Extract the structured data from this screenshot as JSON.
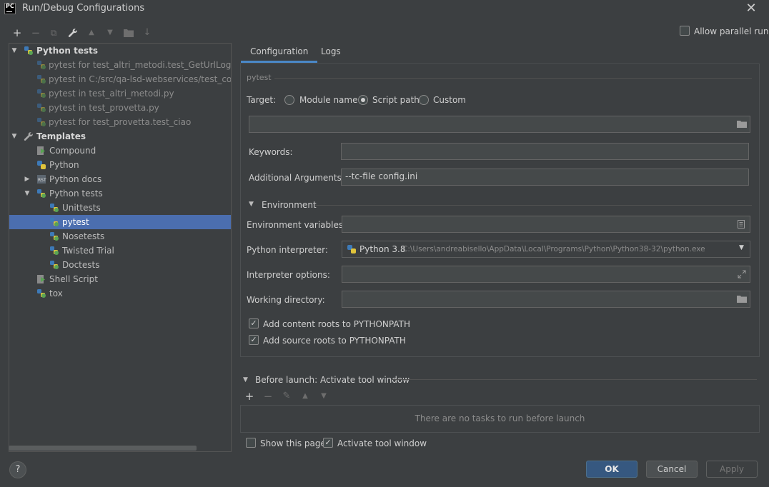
{
  "window": {
    "title": "Run/Debug Configurations",
    "icon_text": "PC",
    "close": "✕"
  },
  "toolbar": {
    "add": "+",
    "remove": "−",
    "copy": "⧉",
    "edit_templates": "🔧",
    "move_up": "▲",
    "move_down": "▼",
    "folder": "📁",
    "sort": "↓"
  },
  "parallel": {
    "label": "Allow parallel run",
    "checked": false
  },
  "tree": {
    "python_tests": "Python tests",
    "items": [
      "pytest for test_altri_metodi.test_GetUrlLoginUser",
      "pytest in C:/src/qa-lsd-webservices/test_configu",
      "pytest in test_altri_metodi.py",
      "pytest in test_provetta.py",
      "pytest for test_provetta.test_ciao"
    ],
    "templates": "Templates",
    "template_items": {
      "compound": "Compound",
      "python": "Python",
      "python_docs": "Python docs",
      "python_tests": "Python tests",
      "unittests": "Unittests",
      "pytest": "pytest",
      "nosetests": "Nosetests",
      "twisted_trial": "Twisted Trial",
      "doctests": "Doctests",
      "shell_script": "Shell Script",
      "tox": "tox"
    }
  },
  "tabs": {
    "configuration": "Configuration",
    "logs": "Logs"
  },
  "form": {
    "section": "pytest",
    "target_label": "Target:",
    "target_options": {
      "module": "Module name",
      "script": "Script path",
      "custom": "Custom"
    },
    "target_selected": "Script path",
    "script_path": "",
    "keywords_label": "Keywords:",
    "keywords_value": "",
    "additional_args_label": "Additional Arguments:",
    "additional_args_value": "--tc-file config.ini",
    "environment_section": "Environment",
    "env_vars_label": "Environment variables:",
    "env_vars_value": "",
    "interpreter_label": "Python interpreter:",
    "interpreter_name": "Python 3.8",
    "interpreter_path": "C:\\Users\\andreabisello\\AppData\\Local\\Programs\\Python\\Python38-32\\python.exe",
    "interpreter_options_label": "Interpreter options:",
    "interpreter_options_value": "",
    "working_dir_label": "Working directory:",
    "working_dir_value": "",
    "content_roots": {
      "label": "Add content roots to PYTHONPATH",
      "checked": true
    },
    "source_roots": {
      "label": "Add source roots to PYTHONPATH",
      "checked": true
    }
  },
  "before_launch": {
    "title": "Before launch: Activate tool window",
    "empty_text": "There are no tasks to run before launch",
    "add": "+",
    "remove": "−",
    "edit": "✎",
    "up": "▲",
    "down": "▼"
  },
  "bottom_options": {
    "show_page": {
      "label": "Show this page",
      "checked": false
    },
    "activate_tool_window": {
      "label": "Activate tool window",
      "checked": true
    }
  },
  "buttons": {
    "help": "?",
    "ok": "OK",
    "cancel": "Cancel",
    "apply": "Apply"
  },
  "colors": {
    "background": "#3c3f41",
    "selection": "#4b6eaf",
    "accent": "#4a88c7",
    "ok_button": "#365880"
  }
}
